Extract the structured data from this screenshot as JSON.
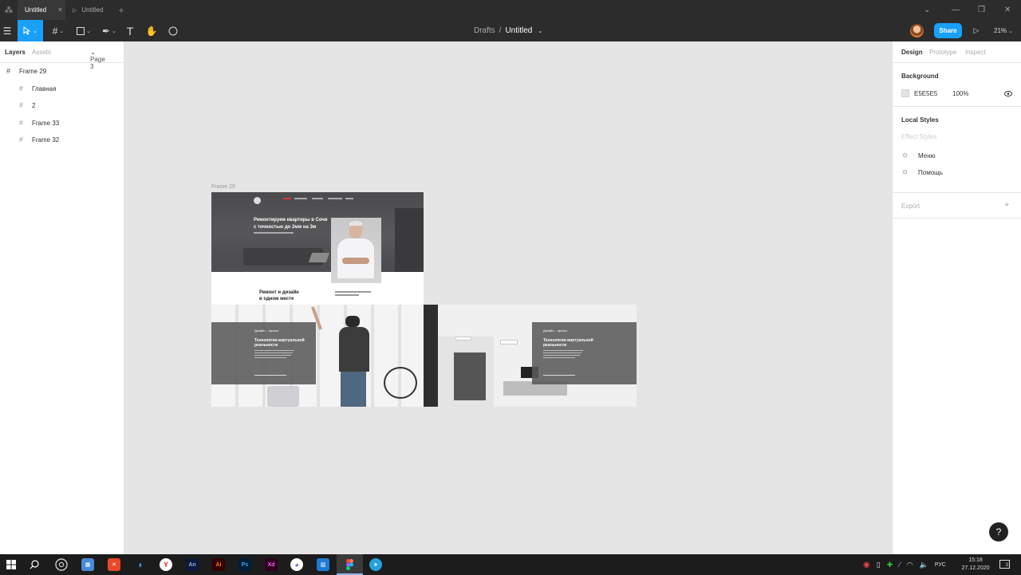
{
  "tabs": [
    {
      "label": "Untitled",
      "active": true
    },
    {
      "label": "Untitled",
      "active": false
    }
  ],
  "toolbar": {
    "breadcrumb_parent": "Drafts",
    "breadcrumb_sep": "/",
    "file_name": "Untitled",
    "share_label": "Share",
    "zoom": "21%"
  },
  "left_panel": {
    "tabs": [
      "Layers",
      "Assets"
    ],
    "page": "Page 3",
    "layers": [
      {
        "name": "Frame 29",
        "level": 0
      },
      {
        "name": "Главная",
        "level": 1
      },
      {
        "name": "2",
        "level": 1
      },
      {
        "name": "Frame 33",
        "level": 1
      },
      {
        "name": "Frame 32",
        "level": 1
      }
    ]
  },
  "right_panel": {
    "tabs": [
      "Design",
      "Prototype",
      "Inspect"
    ],
    "background_title": "Background",
    "background_hex": "E5E5E5",
    "background_opacity": "100%",
    "local_styles_title": "Local Styles",
    "effect_styles_label": "Effect Styles",
    "styles": [
      "Меню",
      "Помощь"
    ],
    "export_title": "Export"
  },
  "canvas": {
    "frame_label": "Frame 29",
    "hero_title_line1": "Ремонтируем квартиры в Сочи",
    "hero_title_line2": "с точностью до 2мм на 3м",
    "section_title_line1": "Ремонт и дизайн",
    "section_title_line2": "в одном месте",
    "card_label": "Дизайн – проект",
    "card_title_line1": "Технологии виртуальной",
    "card_title_line2": "реальности",
    "background_color": "#E5E5E5"
  },
  "taskbar": {
    "lang": "РУС",
    "time": "15:18",
    "date": "27.12.2020",
    "notif_count": "3",
    "apps": [
      "An",
      "Ai",
      "Ps",
      "Xd"
    ]
  },
  "colors": {
    "accent": "#18a0fb",
    "toolbar_bg": "#2c2c2c",
    "canvas_bg": "#e5e5e5"
  }
}
